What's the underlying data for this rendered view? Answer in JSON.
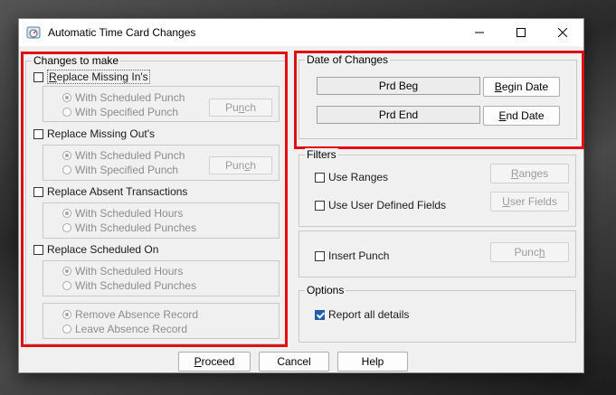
{
  "window": {
    "title": "Automatic Time Card Changes",
    "icon": "clock-gauge-icon",
    "controls": [
      "minimize-icon",
      "maximize-icon",
      "close-icon"
    ]
  },
  "changes_to_make": {
    "label": "Changes to make",
    "sections": [
      {
        "checkbox": {
          "before": "",
          "mnemonic": "R",
          "after": "eplace Missing In's",
          "checked": false
        },
        "options": [
          {
            "label": "With Scheduled Punch",
            "selected": true
          },
          {
            "label": "With Specified Punch",
            "selected": false
          }
        ],
        "button": {
          "before": "Pu",
          "mnemonic": "n",
          "after": "ch"
        }
      },
      {
        "checkbox": {
          "before": "Replace Missing Out's",
          "mnemonic": "",
          "after": "",
          "checked": false
        },
        "options": [
          {
            "label": "With Scheduled Punch",
            "selected": true
          },
          {
            "label": "With Specified Punch",
            "selected": false
          }
        ],
        "button": {
          "before": "Pun",
          "mnemonic": "c",
          "after": "h"
        }
      },
      {
        "checkbox": {
          "before": "Replace Absent Transactions",
          "mnemonic": "",
          "after": "",
          "checked": false
        },
        "options": [
          {
            "label": "With Scheduled Hours",
            "selected": true
          },
          {
            "label": "With Scheduled Punches",
            "selected": false
          }
        ]
      },
      {
        "checkbox": {
          "before": "Replace Scheduled On",
          "mnemonic": "",
          "after": "",
          "checked": false
        },
        "options": [
          {
            "label": "With Scheduled Hours",
            "selected": true
          },
          {
            "label": "With Scheduled Punches",
            "selected": false
          }
        ]
      }
    ],
    "absence_options": [
      {
        "label": "Remove Absence Record",
        "selected": true
      },
      {
        "label": "Leave Absence Record",
        "selected": false
      }
    ]
  },
  "date_of_changes": {
    "label": "Date of Changes",
    "prd_beg": "Prd Beg",
    "prd_end": "Prd End",
    "begin_button": {
      "before": "",
      "mnemonic": "B",
      "after": "egin Date"
    },
    "end_button": {
      "before": "",
      "mnemonic": "E",
      "after": "nd Date"
    }
  },
  "filters": {
    "label": "Filters",
    "use_ranges": {
      "label": "Use Ranges",
      "checked": false
    },
    "ranges_button": {
      "before": "",
      "mnemonic": "R",
      "after": "anges"
    },
    "use_user_fields": {
      "label": "Use User Defined Fields",
      "checked": false
    },
    "user_fields_button": {
      "before": "",
      "mnemonic": "U",
      "after": "ser Fields"
    }
  },
  "insert_punch": {
    "label": "Insert Punch",
    "checked": false,
    "button": {
      "before": "Punc",
      "mnemonic": "h",
      "after": ""
    }
  },
  "options": {
    "label": "Options",
    "report_all": {
      "label": "Report all details",
      "checked": true
    }
  },
  "footer": {
    "proceed": {
      "before": "",
      "mnemonic": "P",
      "after": "roceed"
    },
    "cancel": "Cancel",
    "help": "Help"
  },
  "colors": {
    "highlight_border": "#e01010",
    "check_accent": "#1f5ea8"
  }
}
